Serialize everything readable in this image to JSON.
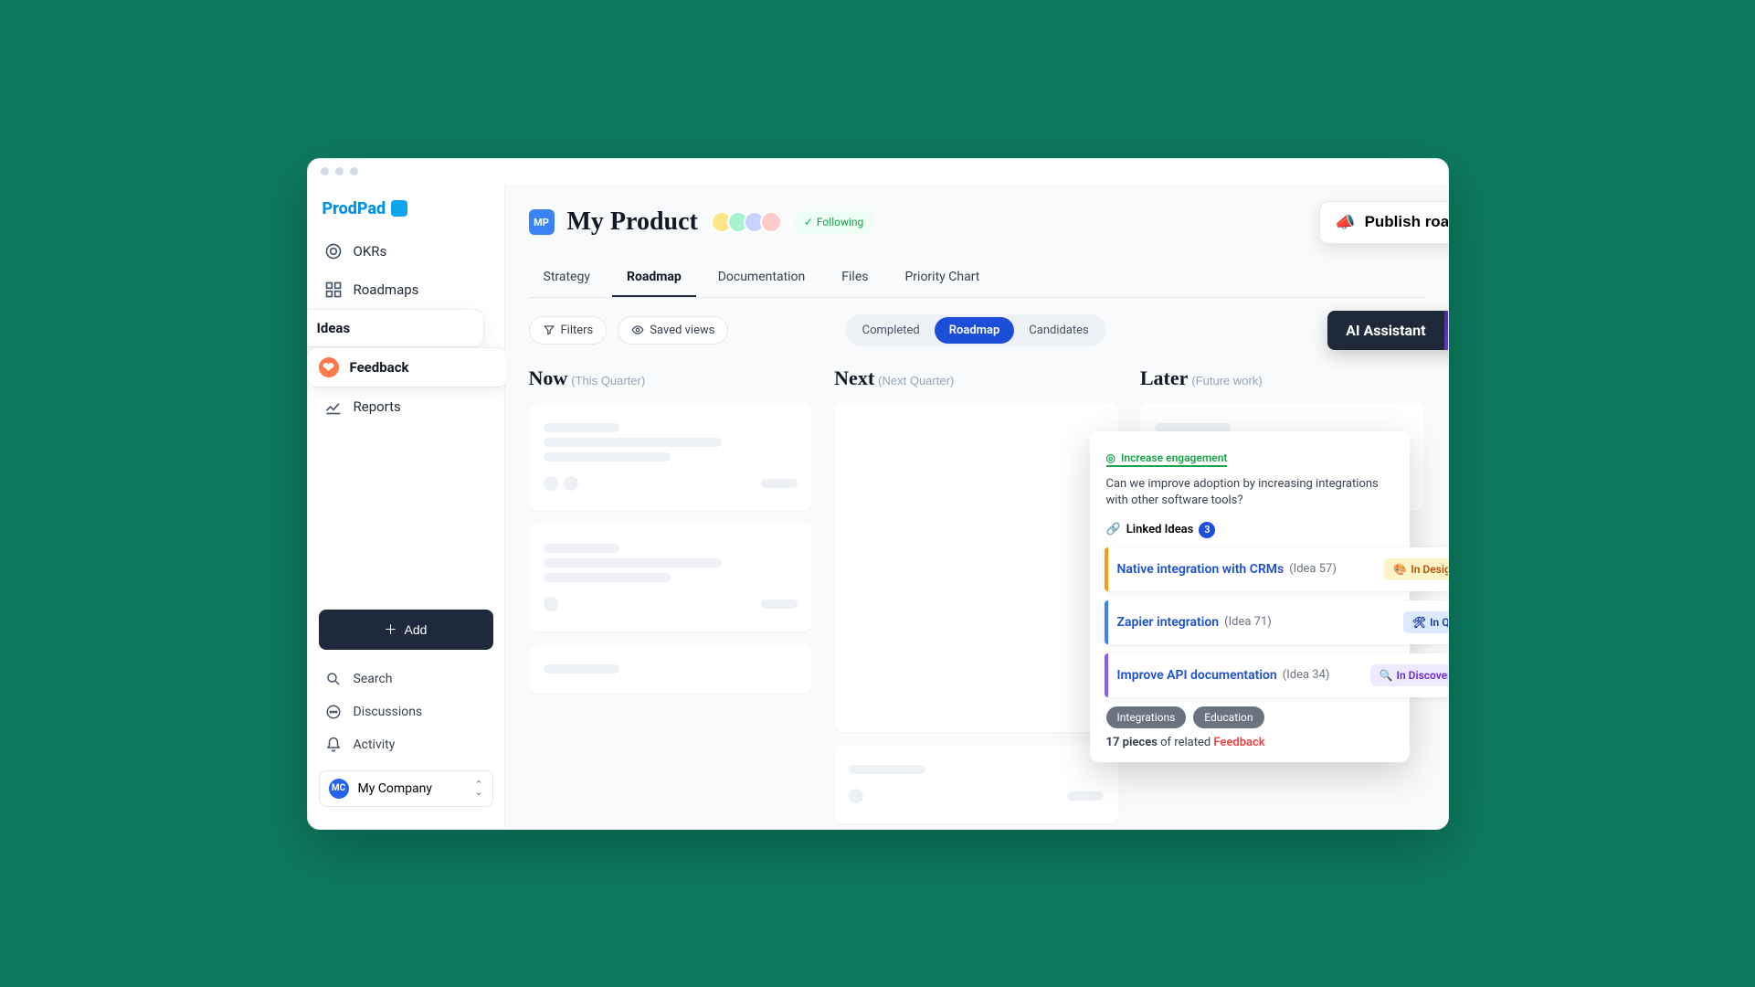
{
  "brand": "ProdPad",
  "sidebar": {
    "items": [
      {
        "label": "OKRs"
      },
      {
        "label": "Roadmaps"
      },
      {
        "label": "Ideas"
      },
      {
        "label": "Feedback"
      },
      {
        "label": "Reports"
      }
    ],
    "add_label": "Add",
    "utils": [
      {
        "label": "Search"
      },
      {
        "label": "Discussions"
      },
      {
        "label": "Activity"
      }
    ],
    "company": {
      "initials": "MC",
      "name": "My Company"
    }
  },
  "header": {
    "product_initials": "MP",
    "product_title": "My Product",
    "follow_label": "Following",
    "publish_label": "Publish roadmap"
  },
  "tabs": [
    {
      "label": "Strategy"
    },
    {
      "label": "Roadmap",
      "active": true
    },
    {
      "label": "Documentation"
    },
    {
      "label": "Files"
    },
    {
      "label": "Priority Chart"
    }
  ],
  "toolbar": {
    "filters": "Filters",
    "saved_views": "Saved views",
    "segments": [
      {
        "label": "Completed"
      },
      {
        "label": "Roadmap",
        "active": true
      },
      {
        "label": "Candidates"
      }
    ],
    "ai_label": "AI Assistant"
  },
  "columns": [
    {
      "title": "Now",
      "sub": "(This Quarter)"
    },
    {
      "title": "Next",
      "sub": "(Next Quarter)"
    },
    {
      "title": "Later",
      "sub": "(Future work)"
    }
  ],
  "popup": {
    "objective": "Increase engagement",
    "question": "Can we improve adoption by increasing integrations with other software tools?",
    "linked_label": "Linked Ideas",
    "linked_count": "3",
    "ideas": [
      {
        "title": "Native integration with CRMs",
        "id": "(Idea 57)",
        "status": "In Design",
        "status_key": "design",
        "bar": "orange"
      },
      {
        "title": "Zapier integration",
        "id": "(Idea 71)",
        "status": "In QA",
        "status_key": "qa",
        "bar": "blue"
      },
      {
        "title": "Improve API documentation",
        "id": "(Idea 34)",
        "status": "In Discovery",
        "status_key": "discovery",
        "bar": "violet"
      }
    ],
    "tags": [
      "Integrations",
      "Education"
    ],
    "feedback_count": "17 pieces",
    "feedback_mid": " of related ",
    "feedback_link": "Feedback"
  }
}
